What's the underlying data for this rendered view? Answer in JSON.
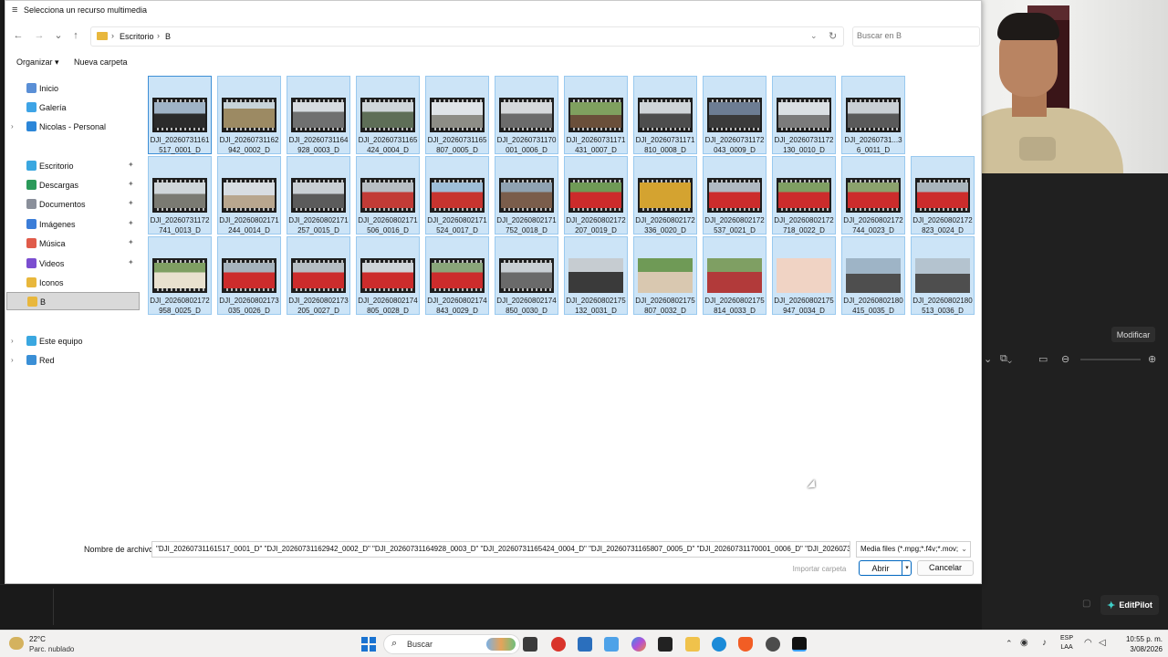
{
  "dialog": {
    "title": "Selecciona un recurso multimedia",
    "breadcrumb": [
      "Escritorio",
      "B"
    ],
    "search_placeholder": "Buscar en B",
    "toolbar": {
      "organize": "Organizar",
      "new_folder": "Nueva carpeta"
    },
    "sidebar": {
      "items": [
        {
          "label": "Inicio",
          "icon": "home-icon"
        },
        {
          "label": "Galería",
          "icon": "gallery-icon"
        },
        {
          "label": "Nicolas - Personal",
          "icon": "cloud-icon"
        },
        {
          "label": "Escritorio",
          "icon": "desktop-icon"
        },
        {
          "label": "Descargas",
          "icon": "download-icon"
        },
        {
          "label": "Documentos",
          "icon": "documents-icon"
        },
        {
          "label": "Imágenes",
          "icon": "pictures-icon"
        },
        {
          "label": "Música",
          "icon": "music-icon"
        },
        {
          "label": "Videos",
          "icon": "videos-icon"
        },
        {
          "label": "Iconos",
          "icon": "folder-icon"
        },
        {
          "label": "B",
          "icon": "folder-icon"
        },
        {
          "label": "Este equipo",
          "icon": "pc-icon"
        },
        {
          "label": "Red",
          "icon": "network-icon"
        }
      ]
    },
    "files": [
      "DJI_20260731161517_0001_D",
      "DJI_20260731162942_0002_D",
      "DJI_20260731164928_0003_D",
      "DJI_20260731165424_0004_D",
      "DJI_20260731165807_0005_D",
      "DJI_20260731170001_0006_D",
      "DJI_20260731171431_0007_D",
      "DJI_20260731171810_0008_D",
      "DJI_20260731172043_0009_D",
      "DJI_20260731172130_0010_D",
      "DJI_20260731...36_0011_D",
      "DJI_20260731172741_0013_D",
      "DJI_20260802171244_0014_D",
      "DJI_20260802171257_0015_D",
      "DJI_20260802171506_0016_D",
      "DJI_20260802171524_0017_D",
      "DJI_20260802171752_0018_D",
      "DJI_20260802172207_0019_D",
      "DJI_20260802172336_0020_D",
      "DJI_20260802172537_0021_D",
      "DJI_20260802172718_0022_D",
      "DJI_20260802172744_0023_D",
      "DJI_20260802172823_0024_D",
      "DJI_20260802172958_0025_D",
      "DJI_20260802173035_0026_D",
      "DJI_20260802173205_0027_D",
      "DJI_20260802174805_0028_D",
      "DJI_20260802174843_0029_D",
      "DJI_20260802174850_0030_D",
      "DJI_20260802175132_0031_D",
      "DJI_20260802175807_0032_D",
      "DJI_20260802175814_0033_D",
      "DJI_20260802175947_0034_D",
      "DJI_20260802180415_0035_D",
      "DJI_20260802180513_0036_D"
    ],
    "file_label": "Nombre de archivo:",
    "file_value": "\"DJI_20260731161517_0001_D\" \"DJI_20260731162942_0002_D\" \"DJI_20260731164928_0003_D\" \"DJI_20260731165424_0004_D\" \"DJI_20260731165807_0005_D\" \"DJI_20260731170001_0006_D\" \"DJI_20260731171431_0007_D\" \"D",
    "filter": "Media files (*.mpg;*.f4v;*.mov;",
    "import_folder": "Importar carpeta",
    "open": "Abrir",
    "cancel": "Cancelar"
  },
  "background_app": {
    "modify": "Modificar",
    "editpilot": "EditPilot"
  },
  "taskbar": {
    "weather_temp": "22°C",
    "weather_cond": "Parc. nublado",
    "search": "Buscar",
    "lang_1": "ESP",
    "lang_2": "LAA",
    "time": "10:55 p. m.",
    "date": "3/08/2026"
  },
  "colors": {
    "selection_fill": "#cce4f7",
    "selection_border": "#99c9ef",
    "accent": "#0067c0"
  }
}
